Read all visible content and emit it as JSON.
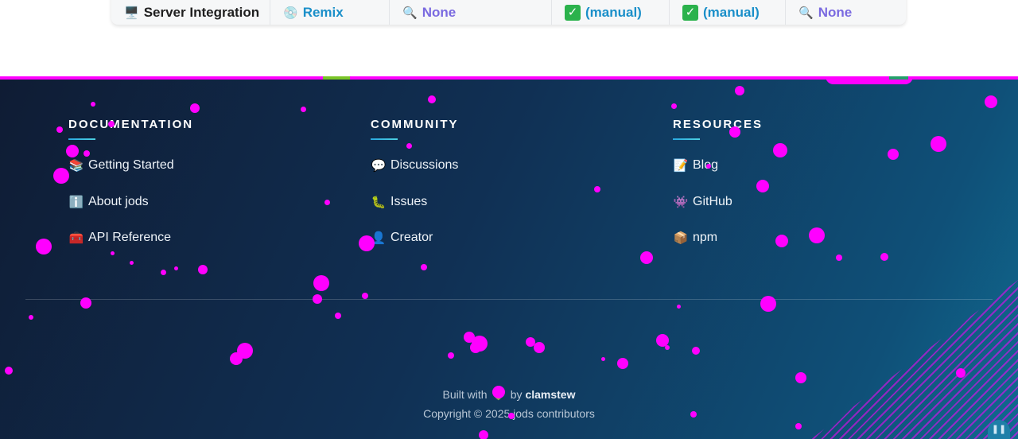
{
  "table_row": {
    "cells": [
      {
        "icon": "🖥️",
        "text": "Server Integration",
        "check": false
      },
      {
        "icon": "💿",
        "text": "Remix",
        "check": false
      },
      {
        "icon": "🔍",
        "text": "None",
        "check": false
      },
      {
        "icon": "✅",
        "text": "(manual)",
        "check": true
      },
      {
        "icon": "✅",
        "text": "(manual)",
        "check": true
      },
      {
        "icon": "🔍",
        "text": "None",
        "check": false
      }
    ]
  },
  "footer": {
    "columns": [
      {
        "title": "DOCUMENTATION",
        "links": [
          {
            "icon": "📚",
            "label": "Getting Started"
          },
          {
            "icon": "ℹ️",
            "label": "About jods"
          },
          {
            "icon": "🧰",
            "label": "API Reference"
          }
        ]
      },
      {
        "title": "COMMUNITY",
        "links": [
          {
            "icon": "💬",
            "label": "Discussions"
          },
          {
            "icon": "🐛",
            "label": "Issues"
          },
          {
            "icon": "👤",
            "label": "Creator"
          }
        ]
      },
      {
        "title": "RESOURCES",
        "links": [
          {
            "icon": "📝",
            "label": "Blog"
          },
          {
            "icon": "👾",
            "label": "GitHub"
          },
          {
            "icon": "📦",
            "label": "npm"
          }
        ]
      }
    ],
    "built_prefix": "Built with",
    "heart_icon": "💚",
    "built_by": "by",
    "author": "clamstew",
    "copyright": "Copyright © 2025 jods contributors",
    "corner_button_icon": "pause-icon"
  },
  "colors": {
    "footer_gradient_start": "#0f1c34",
    "footer_gradient_end": "#106a8f",
    "accent_magenta": "#ff00ff",
    "link_blue": "#1a8fc9",
    "link_purple": "#7a6ae0"
  }
}
